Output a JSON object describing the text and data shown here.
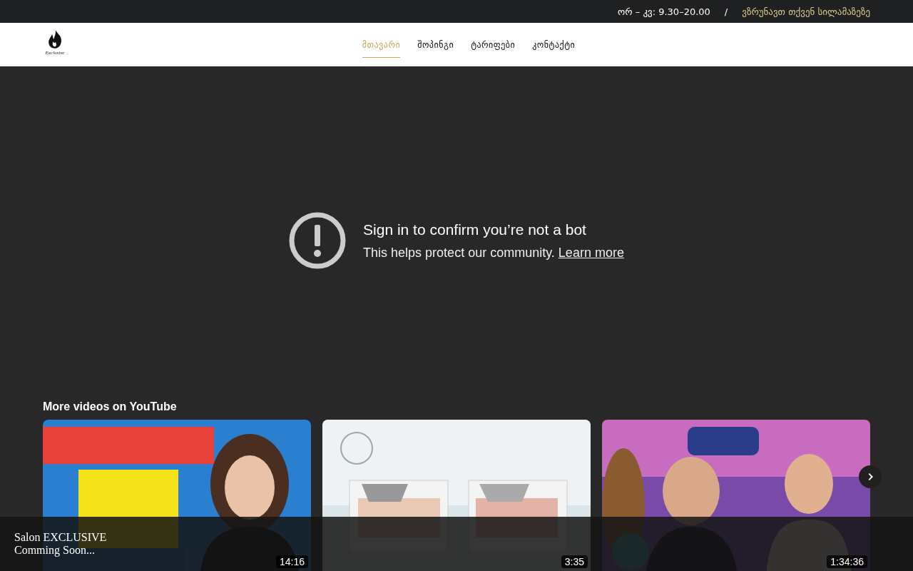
{
  "top_bar": {
    "hours": "ორ – კვ: 9.30–20.00",
    "separator": "/",
    "slogan": "ვზრუნავთ თქვენ სილამაზეზე"
  },
  "header": {
    "logo_text": "Exclusive",
    "nav": [
      {
        "label": "მთავარი",
        "selected": true
      },
      {
        "label": "შოპინგი",
        "selected": false
      },
      {
        "label": "ტარიფები",
        "selected": false
      },
      {
        "label": "კონტაქტი",
        "selected": false
      }
    ]
  },
  "video": {
    "message_title": "Sign in to confirm you’re not a bot",
    "message_text": "This helps protect our community.",
    "link": "Learn more",
    "more_title": "More videos on YouTube",
    "videos": [
      {
        "kind": "picture",
        "duration": "14:16"
      },
      {
        "kind": "picture",
        "duration": "3:35"
      },
      {
        "kind": "picture",
        "duration": "1:34:36"
      }
    ]
  },
  "footer_notice": {
    "lines": [
      "Salon EXCLUSIVE",
      "Comming Soon..."
    ]
  }
}
